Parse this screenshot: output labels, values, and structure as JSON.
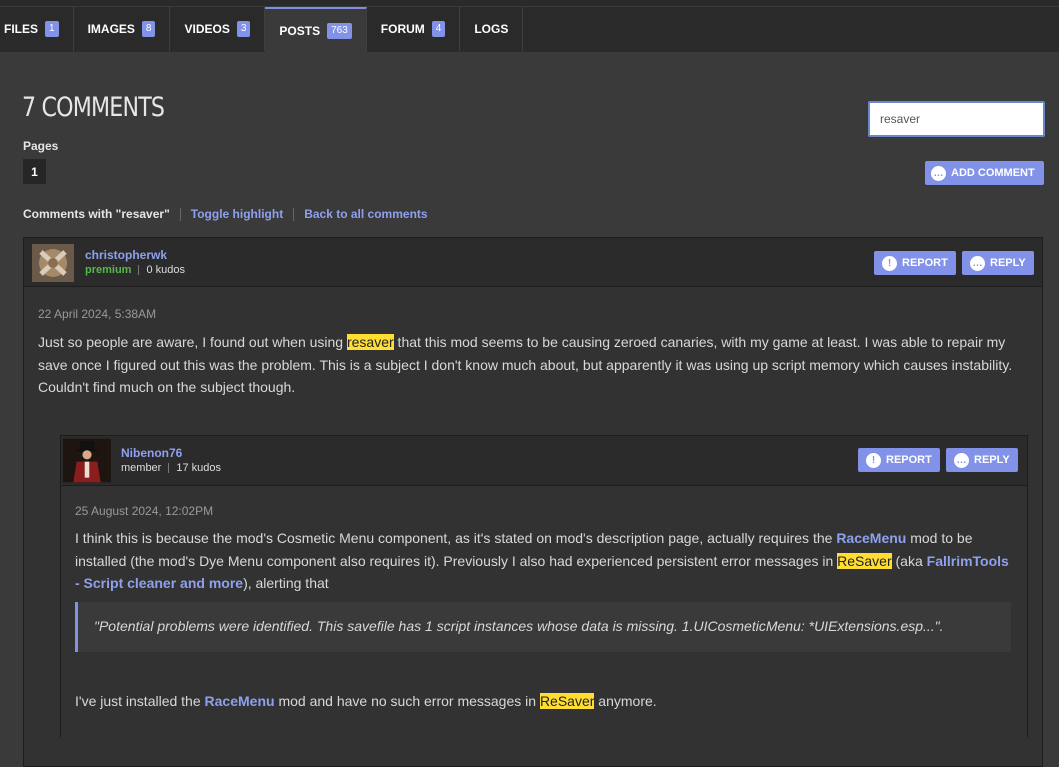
{
  "tabs": [
    {
      "label": "FILES",
      "count": "1"
    },
    {
      "label": "IMAGES",
      "count": "8"
    },
    {
      "label": "VIDEOS",
      "count": "3"
    },
    {
      "label": "POSTS",
      "count": "763"
    },
    {
      "label": "FORUM",
      "count": "4"
    },
    {
      "label": "LOGS",
      "count": ""
    }
  ],
  "header": {
    "title": "7 COMMENTS",
    "pages_label": "Pages",
    "current_page": "1",
    "search_value": "resaver",
    "add_comment": "ADD COMMENT"
  },
  "filter": {
    "label": "Comments with \"resaver\"",
    "toggle": "Toggle highlight",
    "back": "Back to all comments"
  },
  "actions": {
    "report": "REPORT",
    "reply": "REPLY"
  },
  "comment1": {
    "author": "christopherwk",
    "role": "premium",
    "kudos": "0 kudos",
    "date": "22 April 2024, 5:38AM",
    "t1": "Just so people are aware, I found out when using ",
    "h1": "resaver",
    "t2": " that this mod seems to be causing zeroed canaries, with my game at least. I was able to repair my save once I figured out this was the problem. This is a subject I don't know much about, but apparently it was using up script memory which causes instability. Couldn't find much on the subject though."
  },
  "comment2": {
    "author": "Nibenon76",
    "role": "member",
    "kudos": "17 kudos",
    "date": "25 August 2024, 12:02PM",
    "p1a": "I think this is because the mod's Cosmetic Menu component, as it's stated on mod's description page, actually requires the ",
    "link1": "RaceMenu",
    "p1b": " mod to be installed (the mod's Dye Menu component also requires it). Previously I also had experienced persistent error messages in ",
    "hl1": "ReSaver",
    "p1c": " (aka ",
    "link2": "FallrimTools - Script cleaner and more",
    "p1d": "), alerting that",
    "quote": "\"Potential problems were identified. This savefile has 1 script instances whose data is missing. 1.UICosmeticMenu: *UIExtensions.esp...\".",
    "p2a": "I've just installed the ",
    "link3": "RaceMenu",
    "p2b": " mod and have no such error messages in ",
    "hl2": "ReSaver",
    "p2c": " anymore."
  }
}
